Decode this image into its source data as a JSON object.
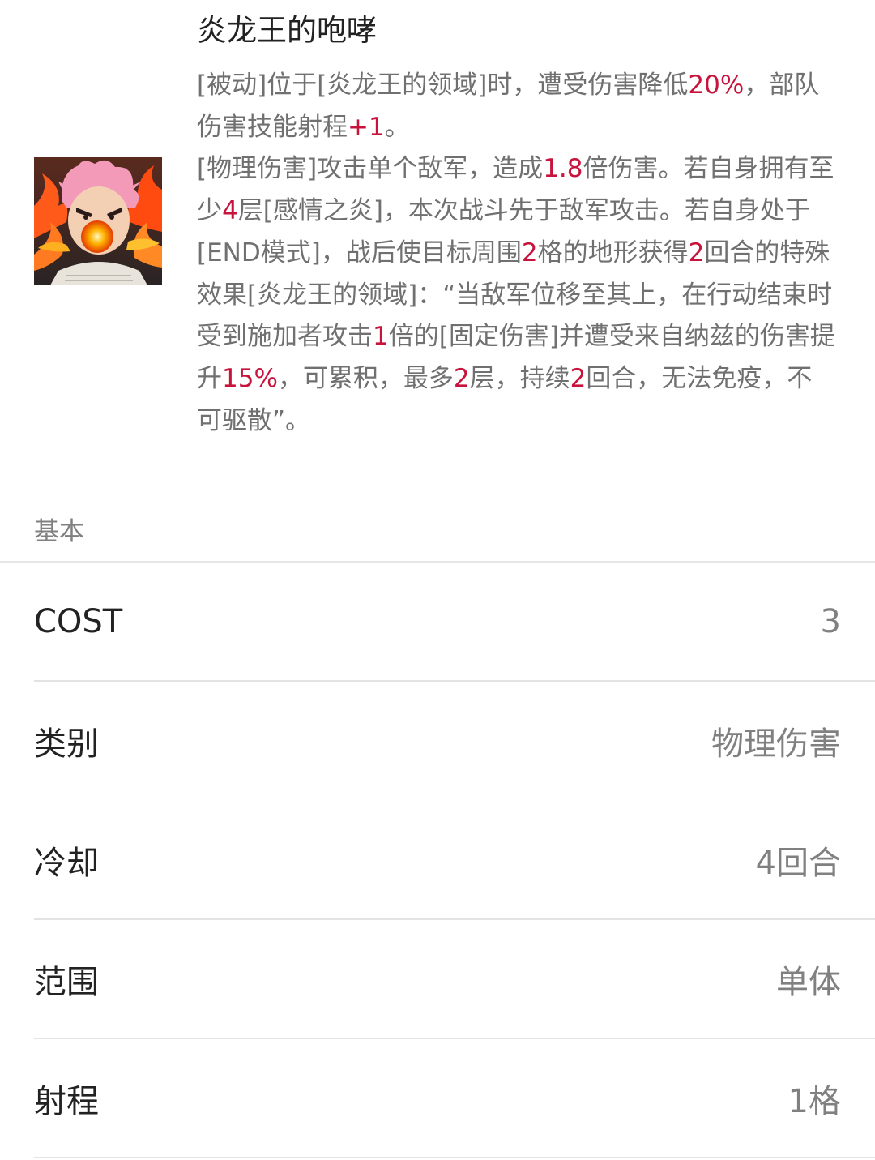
{
  "skill": {
    "title": "炎龙王的咆哮",
    "description_lines": [
      [
        {
          "text": "[被动]位于[炎龙王的领域]时，遭受伤害降低"
        },
        {
          "text": "20%",
          "highlight": true
        },
        {
          "text": "，部队伤害技能射程"
        },
        {
          "text": "+1",
          "highlight": true
        },
        {
          "text": "。"
        }
      ],
      [
        {
          "text": "[物理伤害]攻击单个敌军，造成"
        },
        {
          "text": "1.8",
          "highlight": true
        },
        {
          "text": "倍伤害。若自身拥有至少"
        },
        {
          "text": "4",
          "highlight": true
        },
        {
          "text": "层[感情之炎]，本次战斗先于敌军攻击。若自身处于[END模式]，战后使目标周围"
        },
        {
          "text": "2",
          "highlight": true
        },
        {
          "text": "格的地形获得"
        },
        {
          "text": "2",
          "highlight": true
        },
        {
          "text": "回合的特殊效果[炎龙王的领域]：“当敌军位移至其上，在行动结束时受到施加者攻击"
        },
        {
          "text": "1",
          "highlight": true
        },
        {
          "text": "倍的[固定伤害]并遭受来自纳兹的伤害提升"
        },
        {
          "text": "15%",
          "highlight": true
        },
        {
          "text": "，可累积，最多"
        },
        {
          "text": "2",
          "highlight": true
        },
        {
          "text": "层，持续"
        },
        {
          "text": "2",
          "highlight": true
        },
        {
          "text": "回合，无法免疫，不可驱散”。"
        }
      ]
    ],
    "highlight_color": "#c8143c",
    "icon": "natsu-dragon-roar-icon"
  },
  "basic": {
    "section_label": "基本",
    "rows": [
      {
        "label": "COST",
        "value": "3"
      },
      {
        "label": "类别",
        "value": "物理伤害"
      },
      {
        "label": "冷却",
        "value": "4回合"
      },
      {
        "label": "范围",
        "value": "单体"
      },
      {
        "label": "射程",
        "value": "1格"
      }
    ]
  }
}
